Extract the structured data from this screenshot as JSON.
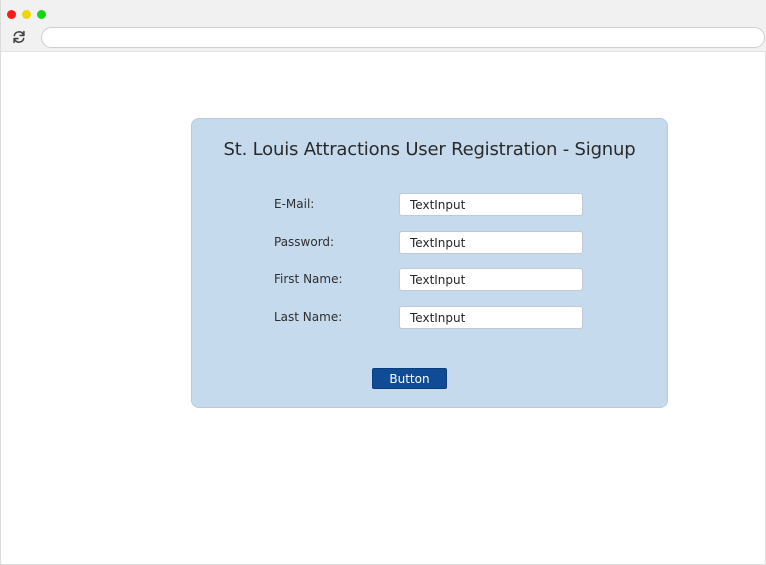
{
  "browser": {
    "controls": {
      "close_color": "#ff1a1a",
      "minimize_color": "#f2d600",
      "maximize_color": "#19d319"
    },
    "reload_icon": "reload-icon",
    "address_bar_value": ""
  },
  "form": {
    "title": "St. Louis Attractions User Registration - Signup",
    "fields": [
      {
        "label": "E-Mail:",
        "value": "TextInput"
      },
      {
        "label": "Password:",
        "value": "TextInput"
      },
      {
        "label": "First Name:",
        "value": "TextInput"
      },
      {
        "label": "Last Name:",
        "value": "TextInput"
      }
    ],
    "button_label": "Button"
  },
  "colors": {
    "card_background": "#c6daee",
    "button_background": "#0f4c95"
  }
}
